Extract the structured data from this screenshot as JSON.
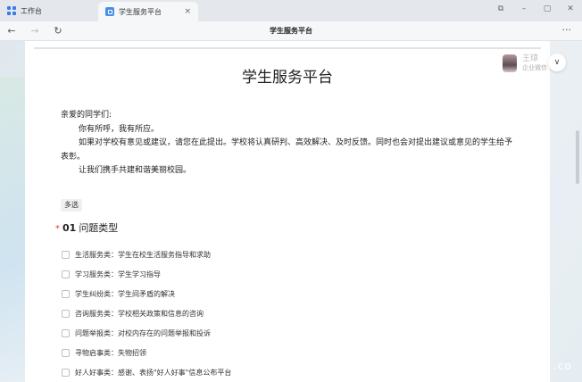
{
  "tabs": [
    {
      "label": "工作台",
      "icon": "grid-icon"
    },
    {
      "label": "学生服务平台",
      "icon": "app-icon",
      "close": "×"
    }
  ],
  "window_controls": {
    "restore": "⧉",
    "minimize": "–",
    "maximize": "▢",
    "close": "✕"
  },
  "address_bar": {
    "back": "←",
    "forward": "→",
    "refresh": "↻",
    "title": "学生服务平台",
    "more": "···"
  },
  "form": {
    "title": "学生服务平台",
    "intro": [
      "亲爱的同学们:",
      "你有所呼，我有所应。",
      "如果对学校有意见或建议，请您在此提出。学校将认真研判、高效解决、及时反馈。同时也会对提出建议或意见的学生给予表彰。",
      "让我们携手共建和谐美丽校园。"
    ],
    "tag": "多选",
    "question": {
      "required_mark": "*",
      "number": "01",
      "label": "问题类型"
    },
    "options": [
      "生活服务类：学生在校生活服务指导和求助",
      "学习服务类：学生学习指导",
      "学生纠纷类：学生间矛盾的解决",
      "咨询服务类：学校相关政策和信息的咨询",
      "问题举报类：对校内存在的问题举报和投诉",
      "寻物启事类：失物招领",
      "好人好事类：感谢、表扬\"好人好事\"信息公布平台"
    ]
  },
  "user": {
    "name": "王琼",
    "subtitle": "企业微信",
    "chevron": "∨"
  },
  "watermark": ".co"
}
